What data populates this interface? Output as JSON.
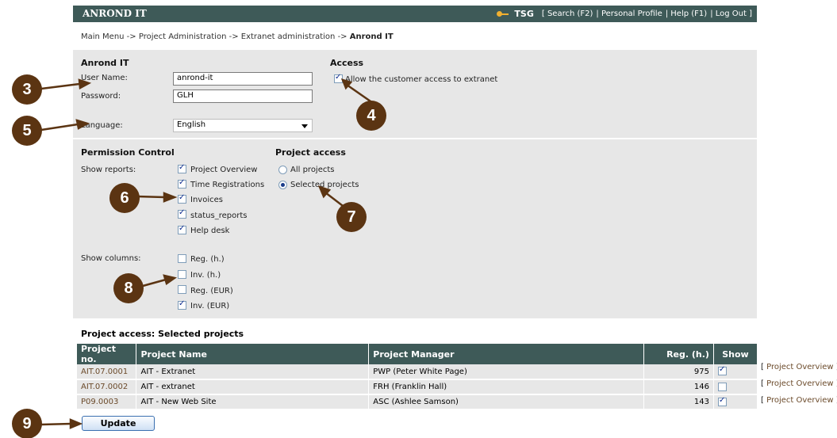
{
  "header": {
    "app_title": "ANROND IT",
    "user": "TSG",
    "links": [
      "[ Search (F2)",
      "| Personal Profile",
      "| Help (F1)",
      "| Log Out ]"
    ]
  },
  "breadcrumb": {
    "path": "Main Menu -> Project Administration -> Extranet administration -> ",
    "current": "Anrond IT"
  },
  "account": {
    "title": "Anrond IT",
    "username_label": "User Name:",
    "username_value": "anrond-it",
    "password_label": "Password:",
    "password_value": "GLH",
    "language_label": "Language:",
    "language_value": "English"
  },
  "access": {
    "title": "Access",
    "allow_label": "Allow the customer access to extranet",
    "allow_checked": true
  },
  "permission": {
    "title": "Permission Control",
    "reports_label": "Show reports:",
    "reports": [
      {
        "label": "Project Overview",
        "checked": true
      },
      {
        "label": "Time Registrations",
        "checked": true
      },
      {
        "label": "Invoices",
        "checked": true
      },
      {
        "label": "status_reports",
        "checked": true
      },
      {
        "label": "Help desk",
        "checked": true
      }
    ],
    "columns_label": "Show columns:",
    "columns": [
      {
        "label": "Reg. (h.)",
        "checked": false
      },
      {
        "label": "Inv. (h.)",
        "checked": false
      },
      {
        "label": "Reg. (EUR)",
        "checked": false
      },
      {
        "label": "Inv. (EUR)",
        "checked": true
      }
    ]
  },
  "project_access": {
    "title": "Project access",
    "options": [
      {
        "label": "All projects",
        "selected": false
      },
      {
        "label": "Selected projects",
        "selected": true
      }
    ]
  },
  "projects_table": {
    "title": "Project access: Selected projects",
    "columns": [
      "Project no.",
      "Project Name",
      "Project Manager",
      "Reg. (h.)",
      "Show"
    ],
    "rows": [
      {
        "no": "AIT.07.0001",
        "name": "AIT - Extranet",
        "manager": "PWP (Peter White Page)",
        "reg": "975",
        "show": true,
        "link": "Project Overview"
      },
      {
        "no": "AIT.07.0002",
        "name": "AIT - extranet",
        "manager": "FRH (Franklin Hall)",
        "reg": "146",
        "show": false,
        "link": "Project Overview"
      },
      {
        "no": "P09.0003",
        "name": "AIT - New Web Site",
        "manager": "ASC (Ashlee Samson)",
        "reg": "143",
        "show": true,
        "link": "Project Overview"
      }
    ]
  },
  "update_button": "Update",
  "callouts": [
    "3",
    "4",
    "5",
    "6",
    "7",
    "8",
    "9"
  ],
  "colors": {
    "header_bg": "#3e5a58",
    "panel_bg": "#e7e7e7",
    "callout": "#5b3412",
    "link": "#6b4a2a"
  }
}
